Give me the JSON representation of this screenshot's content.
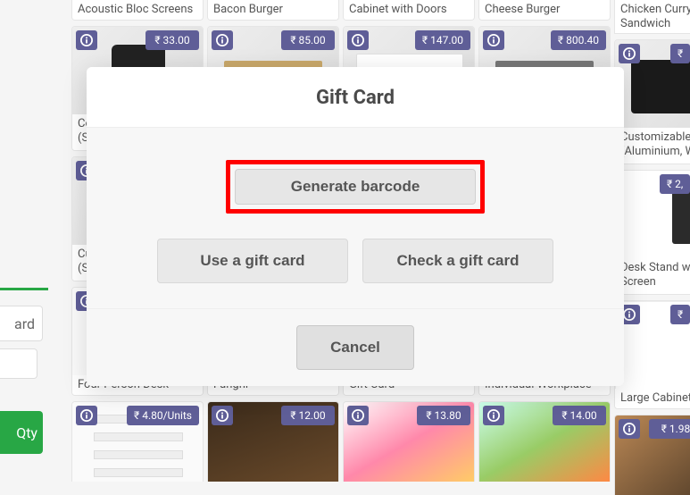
{
  "left_panel": {
    "ard_label": "ard",
    "qty_label": "Qty"
  },
  "modal": {
    "title": "Gift Card",
    "generate_label": "Generate barcode",
    "use_label": "Use a gift card",
    "check_label": "Check a gift card",
    "cancel_label": "Cancel"
  },
  "currency": "₹",
  "columns": {
    "c1": {
      "row0_label": "Acoustic Bloc Screens",
      "row1": {
        "price": "₹ 33.00",
        "label": "Conference Chair (Steel)"
      },
      "row2": {
        "price": "₹",
        "label": "Customizable Desk (Steel)"
      },
      "row3": {
        "price": "₹",
        "label": "Four Person Desk"
      },
      "row4": {
        "price": "₹ 4.80/Units"
      }
    },
    "c2": {
      "row0_label": "Bacon Burger",
      "row1": {
        "price": "₹ 85.00"
      },
      "row2": {
        "price": "₹"
      },
      "row3": {
        "price": "₹",
        "label": "Funghi"
      },
      "row4": {
        "price": "₹ 12.00"
      }
    },
    "c3": {
      "row0_label": "Cabinet with Doors",
      "row1": {
        "price": "₹ 147.00"
      },
      "row2": {
        "price": "₹"
      },
      "row3": {
        "price": "₹",
        "label": "Gift Card"
      },
      "row4": {
        "price": "₹ 13.80"
      }
    },
    "c4": {
      "row0_label": "Cheese Burger",
      "row1": {
        "price": "₹ 800.40"
      },
      "row2": {
        "label_placeholder": ""
      },
      "row3": {
        "price": "₹",
        "label": "Individual Workplace"
      },
      "row4": {
        "price": "₹ 14.00"
      }
    },
    "c5": {
      "row0_label": "Chicken Curry Sandwich",
      "row1": {
        "price": "₹",
        "label": "Customizable Desk (Aluminium, White)"
      },
      "row2": {
        "price": "₹ 2,",
        "label": "Desk Stand with Screen"
      },
      "row3": {
        "price": "₹",
        "label": "Large Cabinet"
      },
      "row4": {
        "price": "₹ 1.98"
      }
    }
  }
}
